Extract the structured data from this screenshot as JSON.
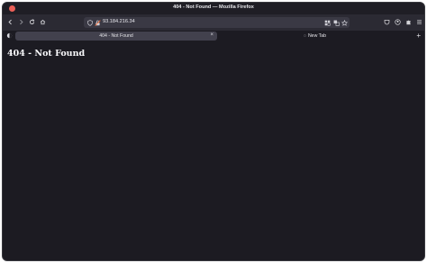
{
  "window": {
    "title": "404 - Not Found — Mozilla Firefox"
  },
  "navbar": {
    "url": "93.184.216.34"
  },
  "tabs": [
    {
      "label": "404 - Not Found",
      "active": true
    },
    {
      "label": "New Tab",
      "active": false
    }
  ],
  "page": {
    "heading": "404 - Not Found"
  },
  "colors": {
    "close_button": "#ec5f57",
    "page_background": "#1c1b22",
    "toolbar_background": "#2b2a33"
  }
}
